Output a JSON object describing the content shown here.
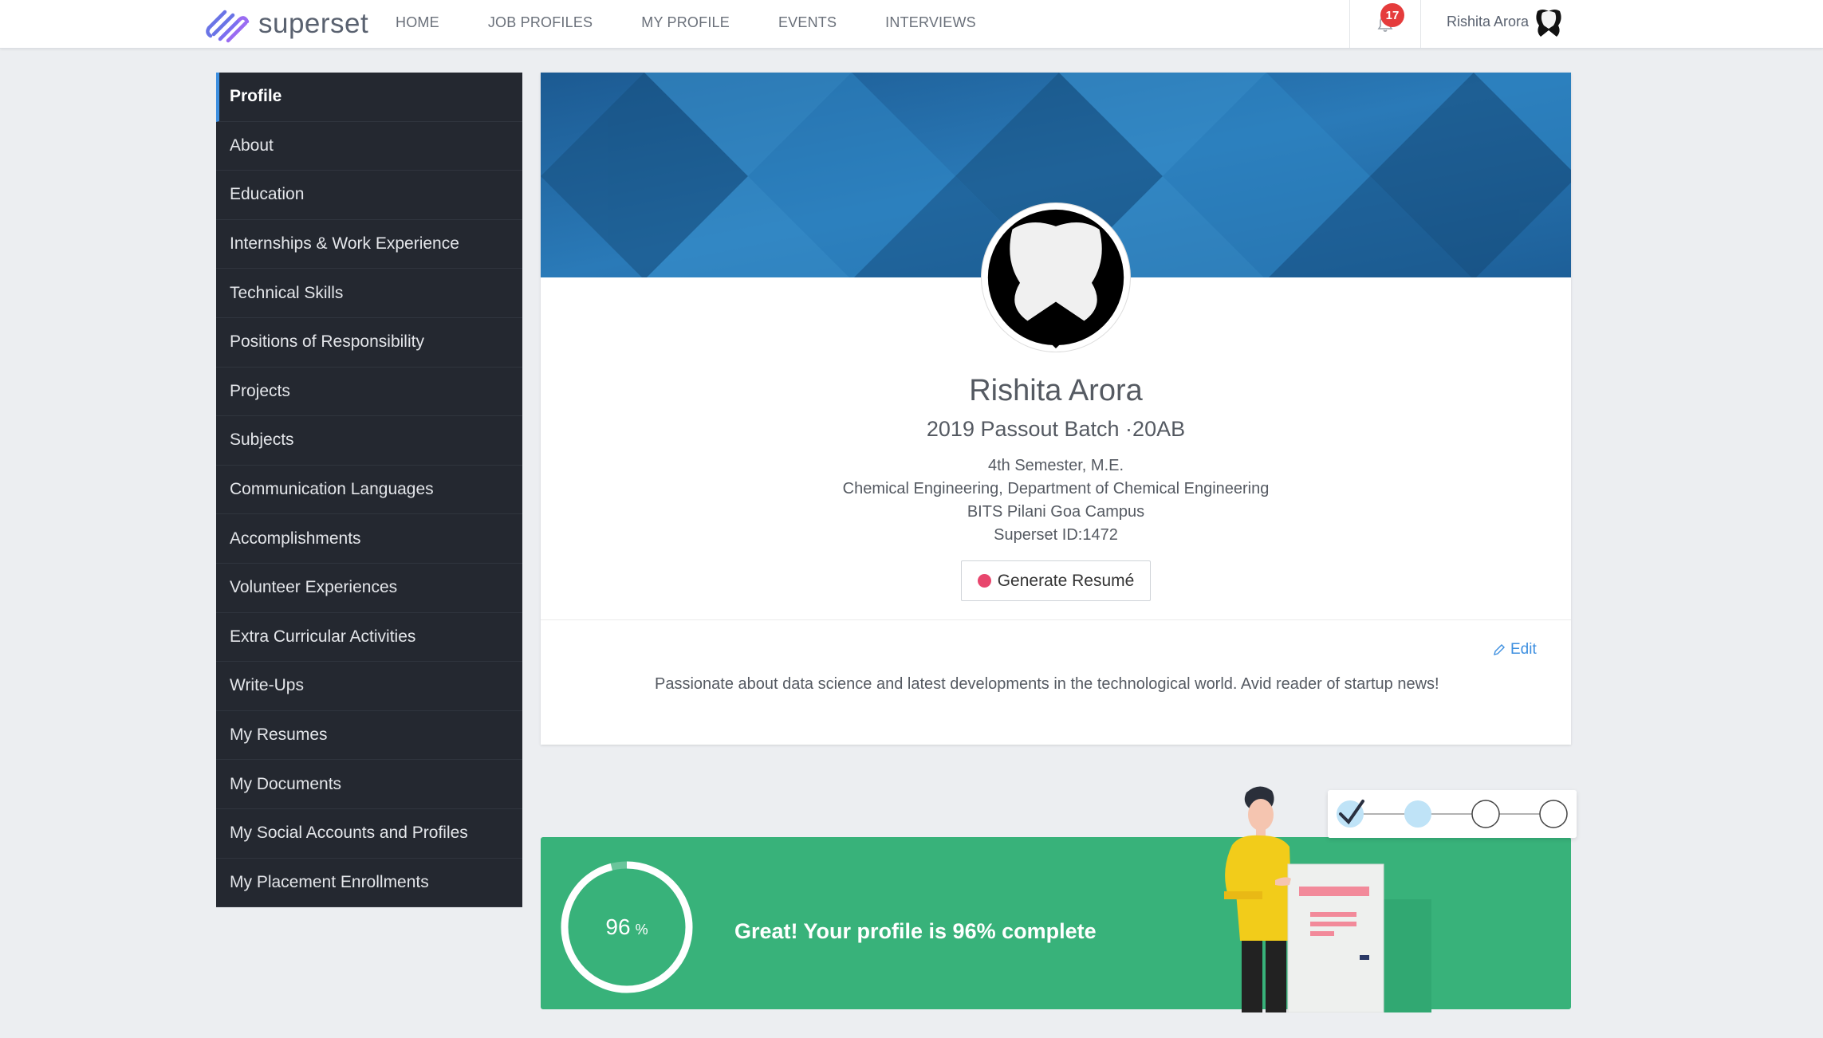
{
  "brand": {
    "name": "superset",
    "accent": "#3d8fe0",
    "logo_colors": [
      "#5a6ee0",
      "#8a6cf0"
    ]
  },
  "nav": [
    {
      "label": "HOME"
    },
    {
      "label": "JOB PROFILES"
    },
    {
      "label": "MY PROFILE"
    },
    {
      "label": "EVENTS"
    },
    {
      "label": "INTERVIEWS"
    }
  ],
  "header": {
    "notification_count": "17",
    "user_name": "Rishita Arora",
    "icons": [
      "bell-icon",
      "user-avatar-icon"
    ]
  },
  "sidebar": {
    "items": [
      {
        "label": "Profile",
        "active": true
      },
      {
        "label": "About"
      },
      {
        "label": "Education"
      },
      {
        "label": "Internships & Work Experience"
      },
      {
        "label": "Technical Skills"
      },
      {
        "label": "Positions of Responsibility"
      },
      {
        "label": "Projects"
      },
      {
        "label": "Subjects"
      },
      {
        "label": "Communication Languages"
      },
      {
        "label": "Accomplishments"
      },
      {
        "label": "Volunteer Experiences"
      },
      {
        "label": "Extra Curricular Activities"
      },
      {
        "label": "Write-Ups"
      },
      {
        "label": "My Resumes"
      },
      {
        "label": "My Documents"
      },
      {
        "label": "My Social Accounts and Profiles"
      },
      {
        "label": "My Placement Enrollments"
      }
    ]
  },
  "profile": {
    "name": "Rishita Arora",
    "batch": "2019 Passout Batch ·20AB",
    "semester": "4th Semester, M.E.",
    "department": "Chemical Engineering, Department of Chemical Engineering",
    "campus": "BITS Pilani Goa Campus",
    "superset_id": "Superset ID:1472",
    "generate_resume_label": "Generate Resumé",
    "edit_label": "Edit",
    "about": "Passionate about data science and latest developments in the technological world. Avid reader of startup news!"
  },
  "completion": {
    "percent": 96,
    "percent_value": "96",
    "percent_unit": "%",
    "message": "Great! Your profile is 96% complete",
    "color": "#38b27a"
  }
}
